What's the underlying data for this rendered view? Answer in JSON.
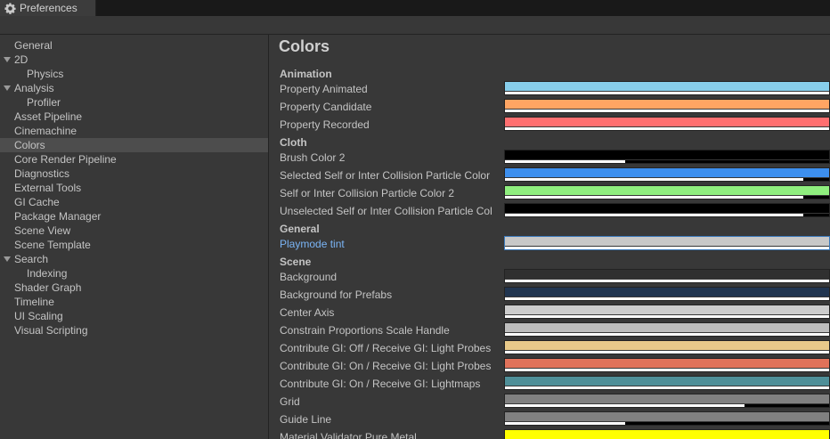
{
  "window": {
    "tab_title": "Preferences",
    "tab_icon": "gear-icon"
  },
  "sidebar": {
    "items": [
      {
        "label": "General",
        "indent": 0,
        "expandable": false,
        "selected": false
      },
      {
        "label": "2D",
        "indent": 0,
        "expandable": true,
        "selected": false
      },
      {
        "label": "Physics",
        "indent": 1,
        "expandable": false,
        "selected": false
      },
      {
        "label": "Analysis",
        "indent": 0,
        "expandable": true,
        "selected": false
      },
      {
        "label": "Profiler",
        "indent": 1,
        "expandable": false,
        "selected": false
      },
      {
        "label": "Asset Pipeline",
        "indent": 0,
        "expandable": false,
        "selected": false
      },
      {
        "label": "Cinemachine",
        "indent": 0,
        "expandable": false,
        "selected": false
      },
      {
        "label": "Colors",
        "indent": 0,
        "expandable": false,
        "selected": true
      },
      {
        "label": "Core Render Pipeline",
        "indent": 0,
        "expandable": false,
        "selected": false
      },
      {
        "label": "Diagnostics",
        "indent": 0,
        "expandable": false,
        "selected": false
      },
      {
        "label": "External Tools",
        "indent": 0,
        "expandable": false,
        "selected": false
      },
      {
        "label": "GI Cache",
        "indent": 0,
        "expandable": false,
        "selected": false
      },
      {
        "label": "Package Manager",
        "indent": 0,
        "expandable": false,
        "selected": false
      },
      {
        "label": "Scene View",
        "indent": 0,
        "expandable": false,
        "selected": false
      },
      {
        "label": "Scene Template",
        "indent": 0,
        "expandable": false,
        "selected": false
      },
      {
        "label": "Search",
        "indent": 0,
        "expandable": true,
        "selected": false
      },
      {
        "label": "Indexing",
        "indent": 1,
        "expandable": false,
        "selected": false
      },
      {
        "label": "Shader Graph",
        "indent": 0,
        "expandable": false,
        "selected": false
      },
      {
        "label": "Timeline",
        "indent": 0,
        "expandable": false,
        "selected": false
      },
      {
        "label": "UI Scaling",
        "indent": 0,
        "expandable": false,
        "selected": false
      },
      {
        "label": "Visual Scripting",
        "indent": 0,
        "expandable": false,
        "selected": false
      }
    ]
  },
  "main": {
    "title": "Colors",
    "rows": [
      {
        "kind": "section",
        "label": "Animation"
      },
      {
        "kind": "color",
        "label": "Property Animated",
        "color": "#87ceeb",
        "alpha": 1.0
      },
      {
        "kind": "color",
        "label": "Property Candidate",
        "color": "#ffa563",
        "alpha": 1.0
      },
      {
        "kind": "color",
        "label": "Property Recorded",
        "color": "#ff6f70",
        "alpha": 1.0
      },
      {
        "kind": "section",
        "label": "Cloth"
      },
      {
        "kind": "color",
        "label": "Brush Color 2",
        "color": "#000000",
        "alpha": 0.37
      },
      {
        "kind": "color",
        "label": "Selected Self or Inter Collision Particle Color",
        "color": "#3d8fee",
        "alpha": 0.92
      },
      {
        "kind": "color",
        "label": "Self or Inter Collision Particle Color 2",
        "color": "#8fee7e",
        "alpha": 0.92
      },
      {
        "kind": "color",
        "label": "Unselected Self or Inter Collision Particle Col",
        "color": "#000000",
        "alpha": 0.92
      },
      {
        "kind": "section",
        "label": "General"
      },
      {
        "kind": "color",
        "label": "Playmode tint",
        "color": "#c8c8c8",
        "alpha": 1.0,
        "link": true,
        "focused": true
      },
      {
        "kind": "section",
        "label": "Scene"
      },
      {
        "kind": "color",
        "label": "Background",
        "color": "#303030",
        "alpha": 1.0
      },
      {
        "kind": "color",
        "label": "Background for Prefabs",
        "color": "#213550",
        "alpha": 1.0
      },
      {
        "kind": "color",
        "label": "Center Axis",
        "color": "#cccccc",
        "alpha": 1.0
      },
      {
        "kind": "color",
        "label": "Constrain Proportions Scale Handle",
        "color": "#bdbdbd",
        "alpha": 1.0
      },
      {
        "kind": "color",
        "label": "Contribute GI: Off / Receive GI: Light Probes",
        "color": "#e8c98a",
        "alpha": 1.0
      },
      {
        "kind": "color",
        "label": "Contribute GI: On / Receive GI: Light Probes",
        "color": "#e0725a",
        "alpha": 1.0
      },
      {
        "kind": "color",
        "label": "Contribute GI: On / Receive GI: Lightmaps",
        "color": "#4f8f98",
        "alpha": 1.0
      },
      {
        "kind": "color",
        "label": "Grid",
        "color": "#808080",
        "alpha": 0.74
      },
      {
        "kind": "color",
        "label": "Guide Line",
        "color": "#808080",
        "alpha": 0.37
      },
      {
        "kind": "color",
        "label": "Material Validator Pure Metal",
        "color": "#ffff00",
        "alpha": 1.0
      }
    ]
  }
}
